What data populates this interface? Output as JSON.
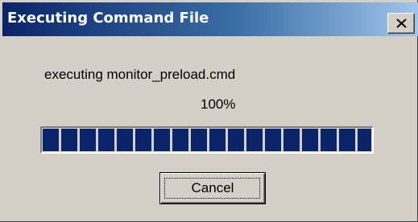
{
  "window": {
    "title": "Executing Command File"
  },
  "titlebar": {
    "close_icon": "close-icon"
  },
  "status": {
    "message": "executing monitor_preload.cmd",
    "percent_text": "100%"
  },
  "progress": {
    "value": 1.0,
    "fill_color": "#0a246a"
  },
  "buttons": {
    "cancel_label": "Cancel"
  },
  "colors": {
    "dialog_background": "#d4d0c8",
    "title_gradient_start": "#0a246a",
    "title_gradient_end": "#a6caf0"
  }
}
